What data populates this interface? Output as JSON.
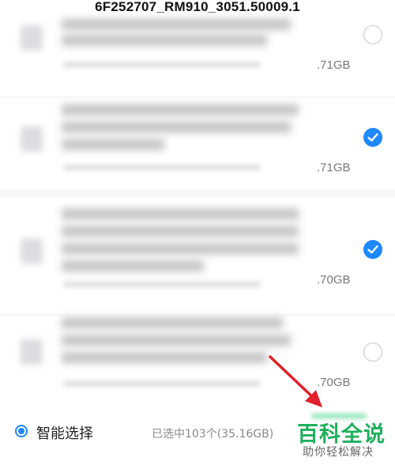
{
  "header": {
    "title": "6F252707_RM910_3051.50009.1"
  },
  "items": [
    {
      "size": ".71GB",
      "checked": false
    },
    {
      "size": ".71GB",
      "checked": true
    },
    {
      "size": ".70GB",
      "checked": true
    },
    {
      "size": ".70GB",
      "checked": false
    }
  ],
  "footer": {
    "smart_select_label": "智能选择",
    "selected_info": "已选中103个(35.16GB)"
  },
  "watermark": {
    "main": "百科全说",
    "sub": "助你轻松解决"
  },
  "colors": {
    "accent": "#1e88ff",
    "watermark": "#1fb05d",
    "arrow": "#e0202a"
  }
}
